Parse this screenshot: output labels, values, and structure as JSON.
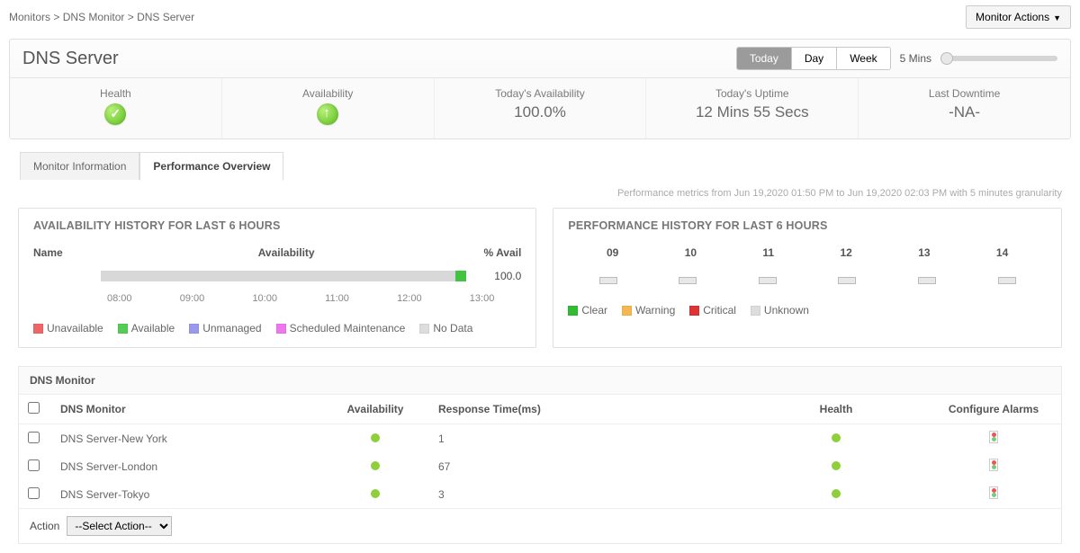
{
  "breadcrumb": {
    "a": "Monitors",
    "b": "DNS Monitor",
    "c": "DNS Server"
  },
  "actions_btn": "Monitor Actions",
  "page_title": "DNS Server",
  "range": {
    "today": "Today",
    "day": "Day",
    "week": "Week",
    "mins": "5 Mins"
  },
  "stats": {
    "health_lbl": "Health",
    "avail_lbl": "Availability",
    "today_avail_lbl": "Today's Availability",
    "today_avail_val": "100.0%",
    "uptime_lbl": "Today's Uptime",
    "uptime_val": "12 Mins 55 Secs",
    "downtime_lbl": "Last Downtime",
    "downtime_val": "-NA-"
  },
  "tabs": {
    "info": "Monitor Information",
    "perf": "Performance Overview"
  },
  "subtext": "Performance metrics from Jun 19,2020 01:50 PM to Jun 19,2020 02:03 PM with 5 minutes granularity",
  "availability": {
    "title": "AVAILABILITY HISTORY FOR LAST 6 HOURS",
    "col_name": "Name",
    "col_avail": "Availability",
    "col_pct": "% Avail",
    "pct_val": "100.0",
    "axis": [
      "08:00",
      "09:00",
      "10:00",
      "11:00",
      "12:00",
      "13:00"
    ],
    "legend": {
      "unavail": "Unavailable",
      "avail": "Available",
      "unman": "Unmanaged",
      "sched": "Scheduled Maintenance",
      "nodata": "No Data"
    }
  },
  "performance": {
    "title": "PERFORMANCE HISTORY FOR LAST 6 HOURS",
    "hours": [
      "09",
      "10",
      "11",
      "12",
      "13",
      "14"
    ],
    "legend": {
      "clear": "Clear",
      "warning": "Warning",
      "critical": "Critical",
      "unknown": "Unknown"
    }
  },
  "table": {
    "title": "DNS Monitor",
    "cols": {
      "name": "DNS Monitor",
      "avail": "Availability",
      "rt": "Response Time(ms)",
      "health": "Health",
      "cfg": "Configure Alarms"
    },
    "rows": [
      {
        "name": "DNS Server-New York",
        "rt": "1"
      },
      {
        "name": "DNS Server-London",
        "rt": "67"
      },
      {
        "name": "DNS Server-Tokyo",
        "rt": "3"
      }
    ],
    "action_lbl": "Action",
    "action_sel": "--Select Action--"
  },
  "chart_data": {
    "type": "bar",
    "title": "Availability History for Last 6 Hours",
    "categories": [
      "08:00",
      "09:00",
      "10:00",
      "11:00",
      "12:00",
      "13:00"
    ],
    "values": [
      100,
      100,
      100,
      100,
      100,
      100
    ],
    "series_states": [
      "Unavailable",
      "Available",
      "Unmanaged",
      "Scheduled Maintenance",
      "No Data"
    ],
    "ylabel": "% Avail",
    "ylim": [
      0,
      100
    ]
  }
}
